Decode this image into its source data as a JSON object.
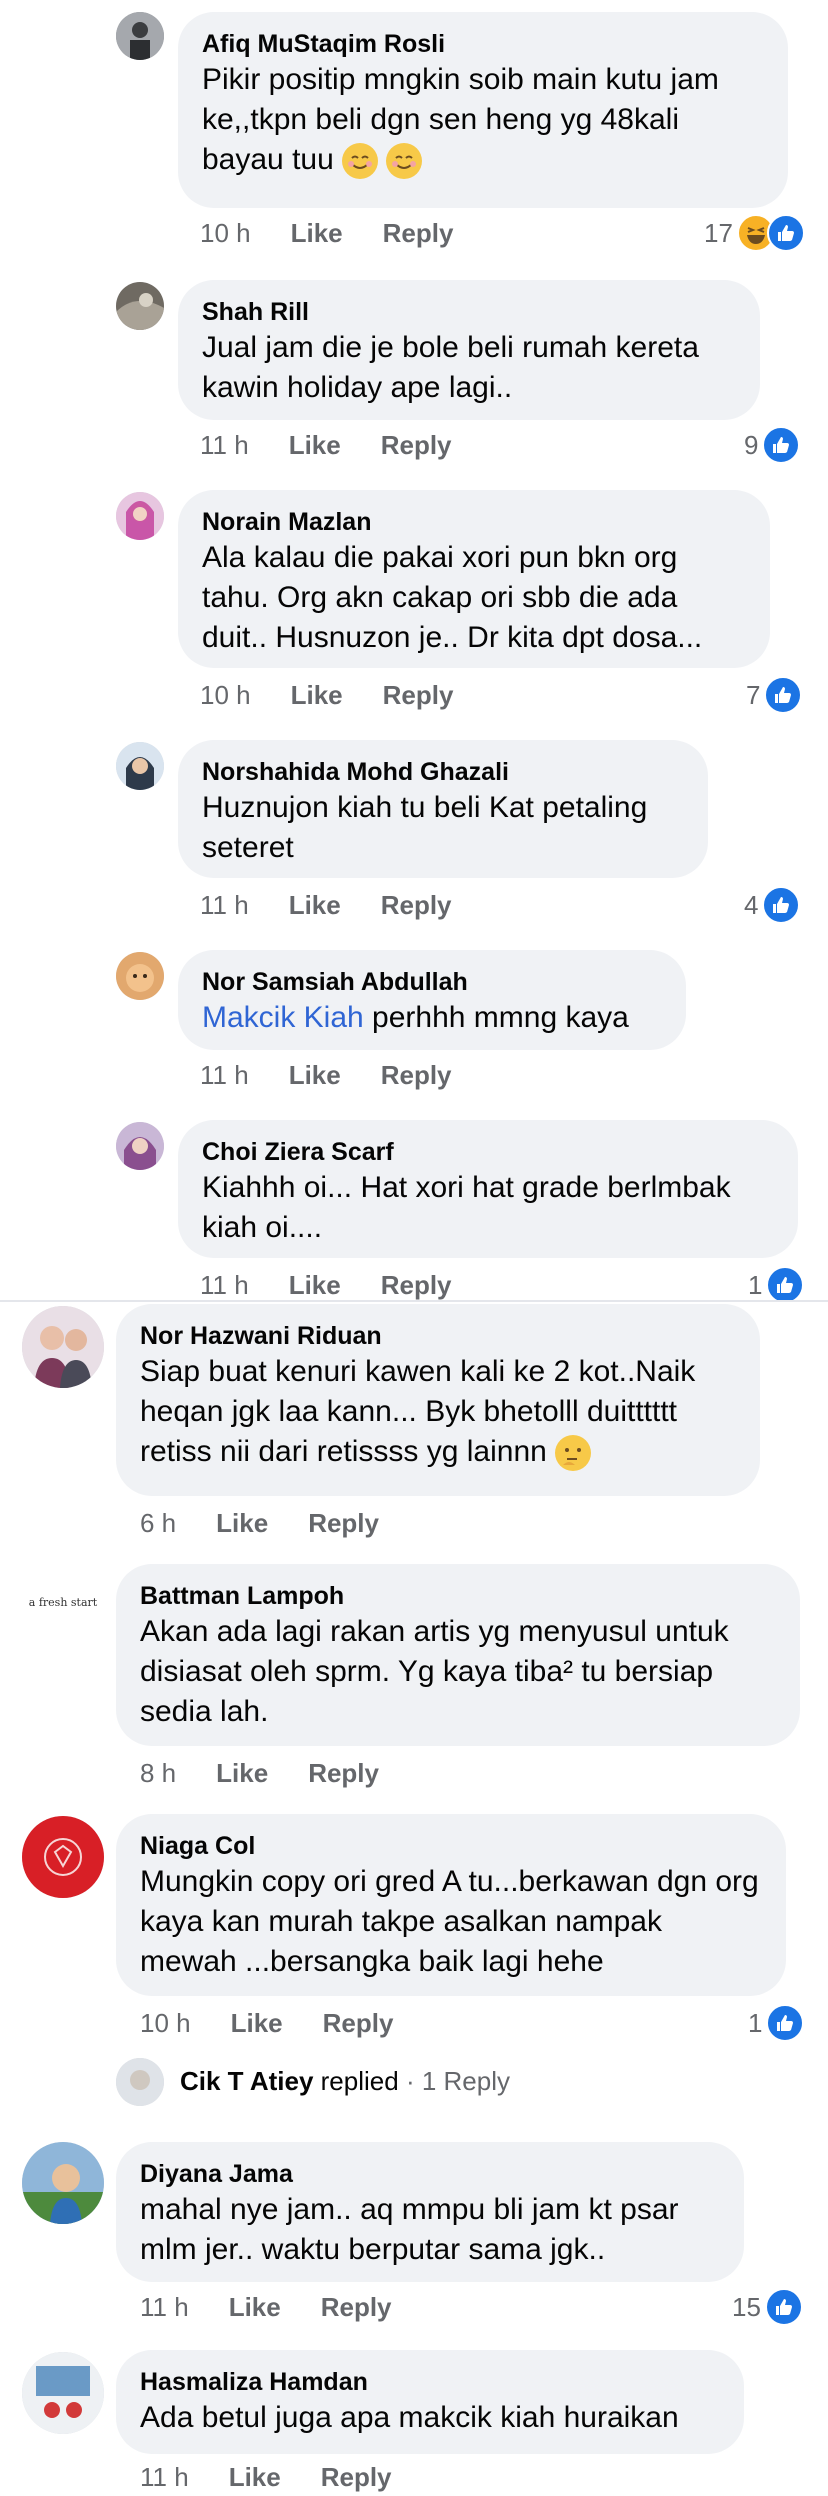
{
  "comments": [
    {
      "author": "Afiq MuStaqim Rosli",
      "text": "Pikir positip mngkin soib main kutu jam ke,,tkpn beli dgn sen heng yg 48kali bayau tuu",
      "time": "10 h",
      "like": "Like",
      "reply": "Reply",
      "reactions": "17"
    },
    {
      "author": "Shah Rill",
      "text": "Jual jam die je bole beli rumah kereta kawin holiday ape lagi..",
      "time": "11 h",
      "like": "Like",
      "reply": "Reply",
      "reactions": "9"
    },
    {
      "author": "Norain Mazlan",
      "text": "Ala kalau die pakai xori pun bkn org tahu. Org akn cakap ori sbb die ada duit.. Husnuzon je.. Dr kita dpt dosa...",
      "time": "10 h",
      "like": "Like",
      "reply": "Reply",
      "reactions": "7"
    },
    {
      "author": "Norshahida Mohd Ghazali",
      "text": "Huznujon kiah tu beli Kat petaling seteret",
      "time": "11 h",
      "like": "Like",
      "reply": "Reply",
      "reactions": "4"
    },
    {
      "author": "Nor Samsiah Abdullah",
      "mention": "Makcik Kiah",
      "text": " perhhh mmng kaya",
      "time": "11 h",
      "like": "Like",
      "reply": "Reply"
    },
    {
      "author": "Choi Ziera Scarf",
      "text": "Kiahhh oi... Hat xori hat grade berlmbak kiah oi....",
      "time": "11 h",
      "like": "Like",
      "reply": "Reply",
      "reactions": "1"
    },
    {
      "author": "Nor Hazwani Riduan",
      "text": "Siap buat kenuri kawen kali ke 2 kot..Naik heqan jgk laa kann... Byk bhetolll duitttttt retiss nii dari retissss yg lainnn",
      "time": "6 h",
      "like": "Like",
      "reply": "Reply"
    },
    {
      "author": "Battman Lampoh",
      "avatar_text": "a fresh start",
      "text": "Akan ada lagi rakan artis yg menyusul untuk disiasat oleh sprm. Yg kaya tiba² tu bersiap sedia lah.",
      "time": "8 h",
      "like": "Like",
      "reply": "Reply"
    },
    {
      "author": "Niaga Col",
      "text": "Mungkin copy ori gred A tu...berkawan dgn org kaya kan murah takpe asalkan nampak mewah ...bersangka baik lagi hehe",
      "time": "10 h",
      "like": "Like",
      "reply": "Reply",
      "reactions": "1"
    },
    {
      "author": "Diyana Jama",
      "text": "mahal nye jam.. aq mmpu bli jam kt psar mlm jer.. waktu berputar sama jgk..",
      "time": "11 h",
      "like": "Like",
      "reply": "Reply",
      "reactions": "15"
    },
    {
      "author": "Hasmaliza Hamdan",
      "text": "Ada betul juga apa makcik kiah huraikan",
      "time": "11 h",
      "like": "Like",
      "reply": "Reply"
    }
  ],
  "replied": {
    "name": "Cik T Atiey",
    "label": "replied",
    "count": "· 1 Reply"
  },
  "colors": {
    "bubble": "#f0f2f5",
    "link": "#2f65d4",
    "like_blue": "#1b74e4",
    "meta": "#65676b"
  }
}
